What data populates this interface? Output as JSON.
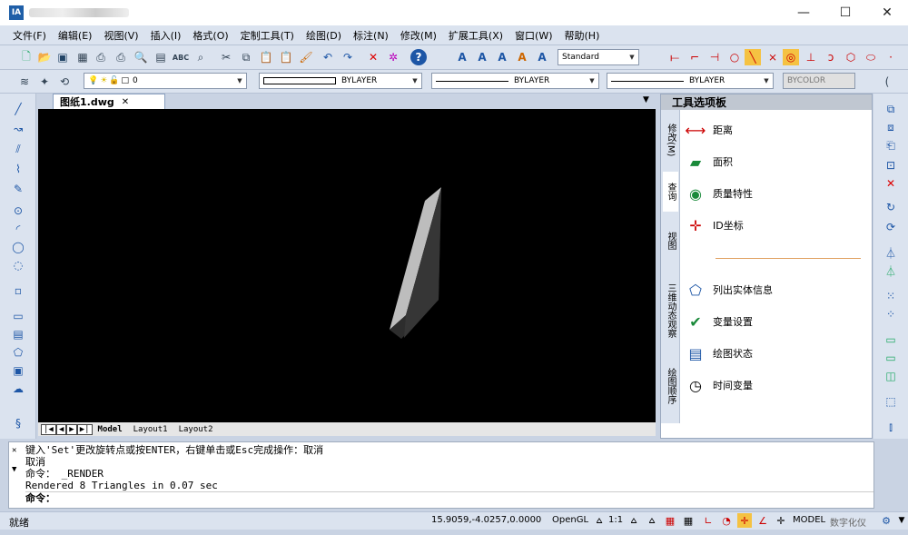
{
  "app": {
    "logo": "IA"
  },
  "window_controls": {
    "minimize": "—",
    "maximize": "☐",
    "close": "✕"
  },
  "menu": [
    "文件(F)",
    "编辑(E)",
    "视图(V)",
    "插入(I)",
    "格式(O)",
    "定制工具(T)",
    "绘图(D)",
    "标注(N)",
    "修改(M)",
    "扩展工具(X)",
    "窗口(W)",
    "帮助(H)"
  ],
  "toolbar": {
    "text_style": "Standard",
    "layer_value": "0",
    "color_value": "BYLAYER",
    "linetype_value": "BYLAYER",
    "lineweight_value": "BYLAYER",
    "plotstyle_value": "BYCOLOR"
  },
  "document": {
    "tab_label": "图纸1.dwg",
    "tab_close": "✕",
    "tab_menu": "▼"
  },
  "layouts": {
    "nav": [
      "|◀",
      "◀",
      "▶",
      "▶|"
    ],
    "tabs": [
      "Model",
      "Layout1",
      "Layout2"
    ]
  },
  "palette": {
    "title": "工具选项板",
    "tabs": [
      "修改(M)",
      "查询",
      "视图",
      "三维动态观察",
      "绘图顺序"
    ],
    "items": [
      {
        "label": "距离",
        "icon": "distance-icon"
      },
      {
        "label": "面积",
        "icon": "area-icon"
      },
      {
        "label": "质量特性",
        "icon": "mass-properties-icon"
      },
      {
        "label": "ID坐标",
        "icon": "id-point-icon"
      },
      {
        "label": "列出实体信息",
        "icon": "list-icon"
      },
      {
        "label": "变量设置",
        "icon": "setvar-icon"
      },
      {
        "label": "绘图状态",
        "icon": "status-icon"
      },
      {
        "label": "时间变量",
        "icon": "time-icon"
      }
    ]
  },
  "command": {
    "lines": [
      "键入'Set'更改旋转点或按ENTER，右键单击或Esc完成操作：取消",
      "取消",
      "命令： _RENDER",
      "Rendered 8 Triangles in 0.07 sec"
    ],
    "prompt": "命令："
  },
  "status": {
    "ready": "就绪",
    "coords": "15.9059,-4.0257,0.0000",
    "renderer": "OpenGL",
    "scale": "1:1",
    "model": "MODEL",
    "digitize": "数字化仪"
  }
}
